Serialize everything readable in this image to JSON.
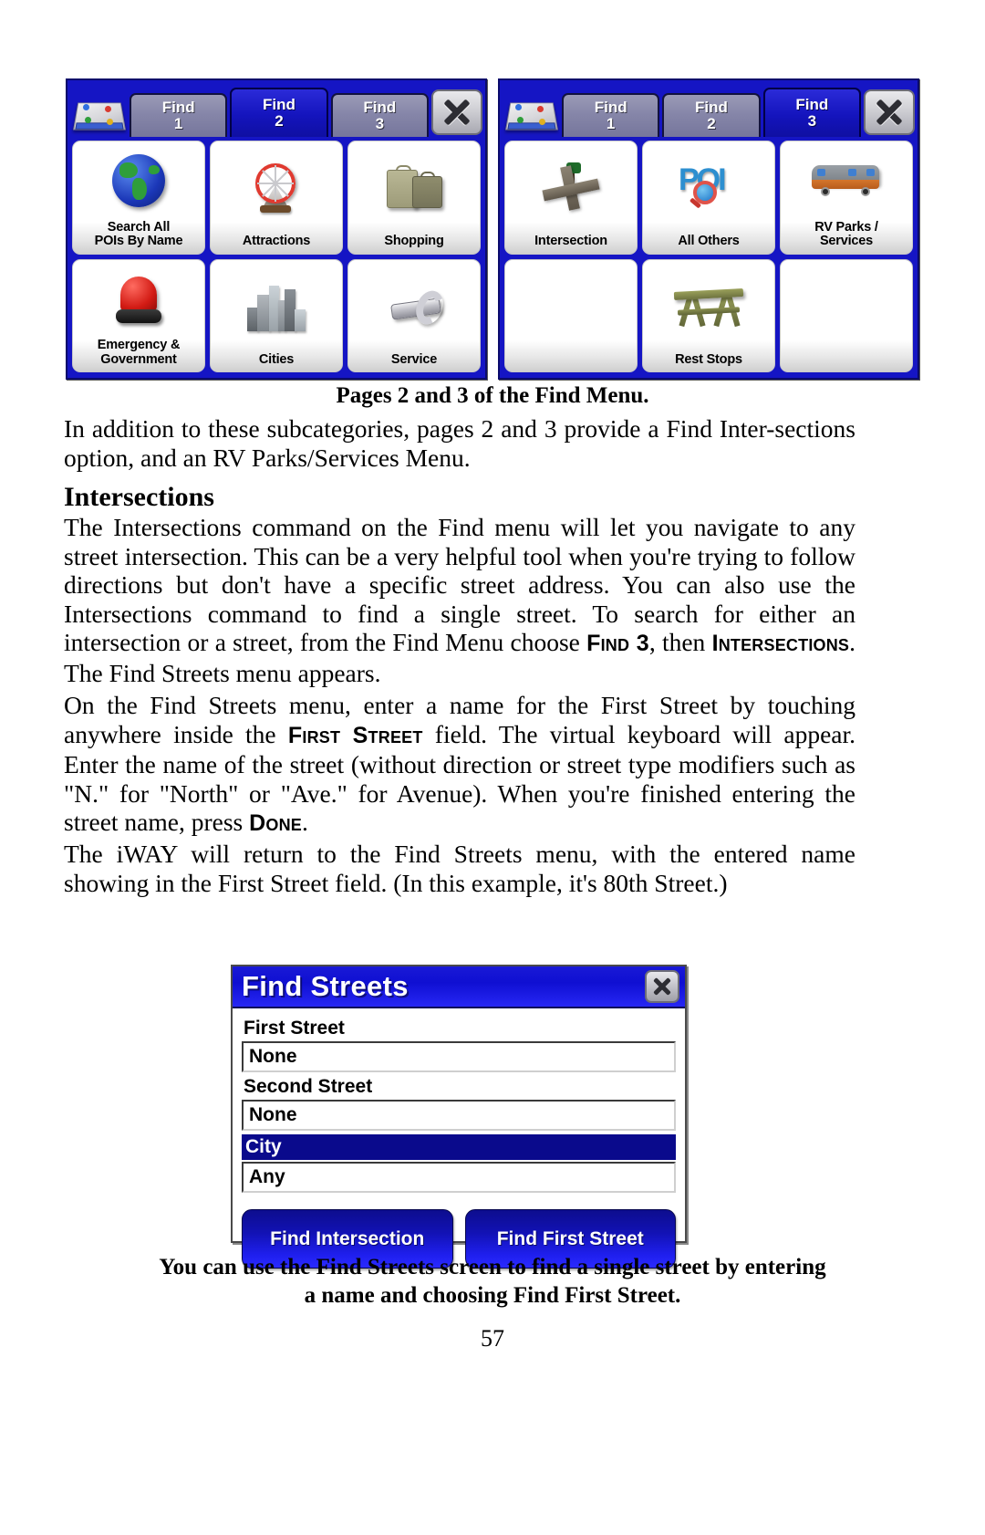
{
  "figure_top": {
    "caption": "Pages 2 and 3 of the Find Menu.",
    "screens": [
      {
        "name": "find-page-2",
        "books_icon": "find-menu-icon",
        "tabs": [
          {
            "line1": "Find",
            "line2": "1",
            "active": false
          },
          {
            "line1": "Find",
            "line2": "2",
            "active": true
          },
          {
            "line1": "Find",
            "line2": "3",
            "active": false
          }
        ],
        "close_icon": "close-icon",
        "cells": [
          {
            "label": "Search All\nPOIs By Name",
            "icon": "globe-icon",
            "empty": false
          },
          {
            "label": "Attractions",
            "icon": "ferris-wheel-icon",
            "empty": false
          },
          {
            "label": "Shopping",
            "icon": "shopping-bags-icon",
            "empty": false
          },
          {
            "label": "Emergency &\nGovernment",
            "icon": "emergency-beacon-icon",
            "empty": false
          },
          {
            "label": "Cities",
            "icon": "city-buildings-icon",
            "empty": false
          },
          {
            "label": "Service",
            "icon": "wrench-icon",
            "empty": false
          }
        ]
      },
      {
        "name": "find-page-3",
        "books_icon": "find-menu-icon",
        "tabs": [
          {
            "line1": "Find",
            "line2": "1",
            "active": false
          },
          {
            "line1": "Find",
            "line2": "2",
            "active": false
          },
          {
            "line1": "Find",
            "line2": "3",
            "active": true
          }
        ],
        "close_icon": "close-icon",
        "cells": [
          {
            "label": "Intersection",
            "icon": "crossroads-icon",
            "empty": false
          },
          {
            "label": "All Others",
            "icon": "poi-magnifier-icon",
            "empty": false
          },
          {
            "label": "RV Parks /\nServices",
            "icon": "rv-icon",
            "empty": false
          },
          {
            "label": "",
            "icon": "",
            "empty": true
          },
          {
            "label": "Rest Stops",
            "icon": "picnic-table-icon",
            "empty": false
          },
          {
            "label": "",
            "icon": "",
            "empty": true
          }
        ]
      }
    ]
  },
  "intro_paragraph": "In addition to these subcategories, pages 2 and 3 provide a Find Inter-sections option, and an RV Parks/Services Menu.",
  "heading": "Intersections",
  "paragraph1": {
    "part1": "The Intersections command on the Find menu will let you navigate to any street intersection. This can be a very helpful tool when you're trying to follow directions but don't have a specific street address. You can also use the Intersections command to find a single street. To search for either an intersection or a street, from the Find Menu choose ",
    "sc1": "Find 3",
    "mid": ", then ",
    "sc2": "Intersections",
    "part2": ". The Find Streets menu appears."
  },
  "paragraph2": {
    "part1": "On the Find Streets menu, enter a name for the First Street by touching anywhere inside the ",
    "sc1": "First Street",
    "part2": " field. The virtual keyboard will appear. Enter the name of the street (without direction or street type modifiers such as \"N.\" for \"North\" or \"Ave.\" for Avenue). When you're finished entering the street name, press ",
    "sc2": "Done",
    "part3": "."
  },
  "paragraph3": "The iWAY will return to the Find Streets menu, with the entered name showing in the First Street field. (In this example, it's 80th Street.)",
  "dialog": {
    "title": "Find Streets",
    "close_icon": "close-icon",
    "fields": [
      {
        "label": "First Street",
        "value": "None",
        "selected": false
      },
      {
        "label": "Second Street",
        "value": "None",
        "selected": false
      },
      {
        "label": "City",
        "value": "Any",
        "selected": true
      }
    ],
    "buttons": [
      {
        "label": "Find Intersection"
      },
      {
        "label": "Find First Street"
      }
    ]
  },
  "figure_bottom": {
    "caption_line1": "You can use the Find Streets screen to find a single street by entering",
    "caption_line2": "a name and choosing Find First Street."
  },
  "page_number": "57",
  "colors": {
    "device_blue": "#1515c4",
    "tab_active": "#1414bd",
    "tab_inactive": "#8585a8",
    "selected_row": "#0a0a8c",
    "button_blue": "#1212b5"
  }
}
